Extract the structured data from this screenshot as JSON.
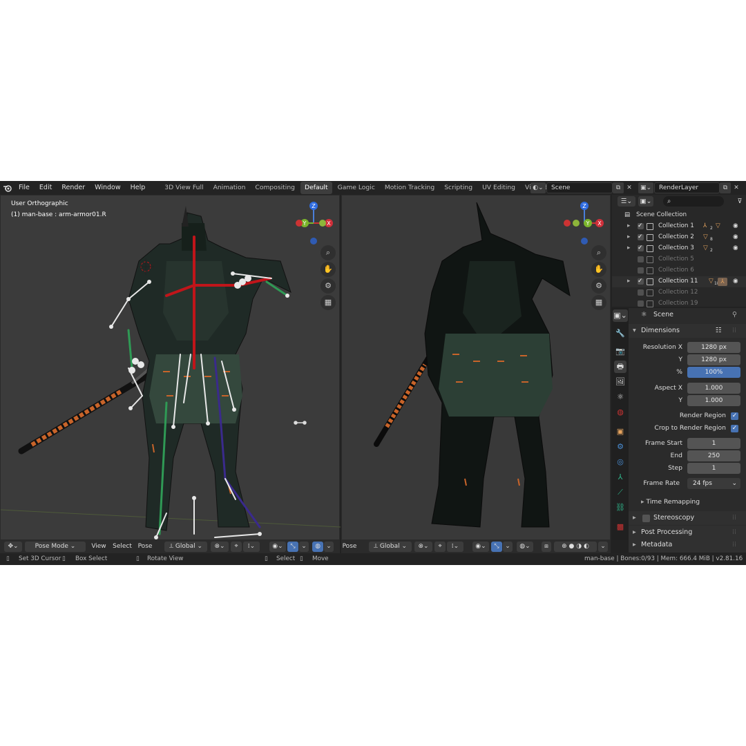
{
  "menu": [
    "File",
    "Edit",
    "Render",
    "Window",
    "Help"
  ],
  "workspaces": [
    "3D View Full",
    "Animation",
    "Compositing",
    "Default",
    "Game Logic",
    "Motion Tracking",
    "Scripting",
    "UV Editing",
    "Video Editing"
  ],
  "workspace_add": "+",
  "scene_name": "Scene",
  "render_layer": "RenderLayer",
  "viewport_left": {
    "view_name": "User Orthographic",
    "active_object": "(1) man-base : arm-armor01.R",
    "mode": "Pose Mode",
    "menus": [
      "View",
      "Select",
      "Pose"
    ],
    "orientation": "Global"
  },
  "viewport_right": {
    "menu": "Pose",
    "orientation": "Global"
  },
  "gizmo": {
    "z": "Z",
    "y": "Y",
    "x": "X"
  },
  "outliner": {
    "root": "Scene Collection",
    "collections": [
      {
        "name": "Collection 1",
        "checked": true,
        "count": "2",
        "extra": ""
      },
      {
        "name": "Collection 2",
        "checked": true,
        "count": "8",
        "extra": ""
      },
      {
        "name": "Collection 3",
        "checked": true,
        "count": "2",
        "extra": ""
      },
      {
        "name": "Collection 5",
        "checked": false,
        "count": "",
        "extra": ""
      },
      {
        "name": "Collection 6",
        "checked": false,
        "count": "",
        "extra": ""
      },
      {
        "name": "Collection 11",
        "checked": true,
        "count": "18",
        "extra": ""
      },
      {
        "name": "Collection 12",
        "checked": false,
        "count": "",
        "extra": ""
      },
      {
        "name": "Collection 19",
        "checked": false,
        "count": "",
        "extra": ""
      }
    ]
  },
  "properties": {
    "context": "Scene",
    "dimensions_title": "Dimensions",
    "resolution_x_label": "Resolution X",
    "resolution_x": "1280 px",
    "resolution_y_label": "Y",
    "resolution_y": "1280 px",
    "percent_label": "%",
    "percent": "100%",
    "aspect_x_label": "Aspect X",
    "aspect_x": "1.000",
    "aspect_y_label": "Y",
    "aspect_y": "1.000",
    "render_region_label": "Render Region",
    "crop_label": "Crop to Render Region",
    "frame_start_label": "Frame Start",
    "frame_start": "1",
    "end_label": "End",
    "end": "250",
    "step_label": "Step",
    "step": "1",
    "frame_rate_label": "Frame Rate",
    "frame_rate": "24 fps",
    "time_remapping": "Time Remapping",
    "stereoscopy": "Stereoscopy",
    "post_processing": "Post Processing",
    "metadata": "Metadata"
  },
  "status": {
    "set_cursor": "Set 3D Cursor",
    "box_select": "Box Select",
    "rotate_view": "Rotate View",
    "select": "Select",
    "move": "Move",
    "info": "man-base | Bones:0/93 | Mem: 666.4 MiB | v2.81.16"
  },
  "colors": {
    "accent": "#4772b3",
    "bone_red": "#c0151a",
    "bone_green": "#2f9a55",
    "bone_purple": "#3a2a8c",
    "armor_orange": "#c8642a"
  }
}
